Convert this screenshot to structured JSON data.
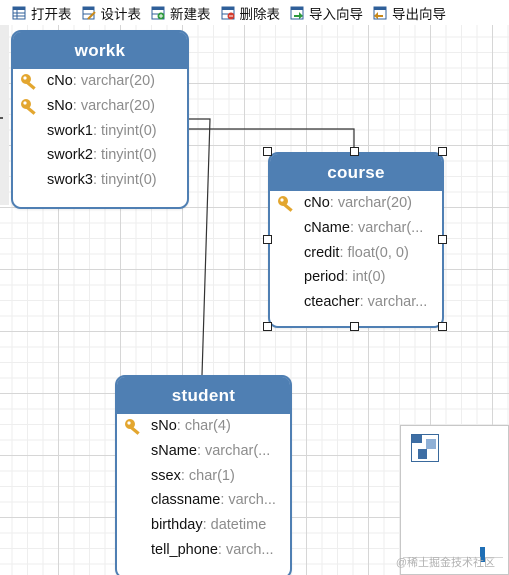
{
  "toolbar": {
    "buttons": [
      {
        "label": "打开表",
        "icon": "open-table-icon"
      },
      {
        "label": "设计表",
        "icon": "design-table-icon"
      },
      {
        "label": "新建表",
        "icon": "new-table-icon"
      },
      {
        "label": "删除表",
        "icon": "delete-table-icon"
      },
      {
        "label": "导入向导",
        "icon": "import-wizard-icon"
      },
      {
        "label": "导出向导",
        "icon": "export-wizard-icon"
      }
    ]
  },
  "colors": {
    "entity_header": "#4f7fb3",
    "field_type": "#8c8c8c",
    "key": "#e3a62f"
  },
  "entities": {
    "workk": {
      "title": "workk",
      "fields": [
        {
          "name": "cNo",
          "type": ": varchar(20)",
          "key": true
        },
        {
          "name": "sNo",
          "type": ": varchar(20)",
          "key": true
        },
        {
          "name": "swork1",
          "type": ": tinyint(0)",
          "key": false
        },
        {
          "name": "swork2",
          "type": ": tinyint(0)",
          "key": false
        },
        {
          "name": "swork3",
          "type": ": tinyint(0)",
          "key": false
        }
      ]
    },
    "course": {
      "title": "course",
      "fields": [
        {
          "name": "cNo",
          "type": ": varchar(20)",
          "key": true
        },
        {
          "name": "cName",
          "type": ": varchar(...",
          "key": false
        },
        {
          "name": "credit",
          "type": ": float(0, 0)",
          "key": false
        },
        {
          "name": "period",
          "type": ": int(0)",
          "key": false
        },
        {
          "name": "cteacher",
          "type": ": varchar...",
          "key": false
        }
      ]
    },
    "student": {
      "title": "student",
      "fields": [
        {
          "name": "sNo",
          "type": ": char(4)",
          "key": true
        },
        {
          "name": "sName",
          "type": ": varchar(...",
          "key": false
        },
        {
          "name": "ssex",
          "type": ": char(1)",
          "key": false
        },
        {
          "name": "classname",
          "type": ": varch...",
          "key": false
        },
        {
          "name": "birthday",
          "type": ": datetime",
          "key": false
        },
        {
          "name": "tell_phone",
          "type": ": varch...",
          "key": false
        }
      ]
    }
  },
  "watermark": "@稀土掘金技术社区"
}
